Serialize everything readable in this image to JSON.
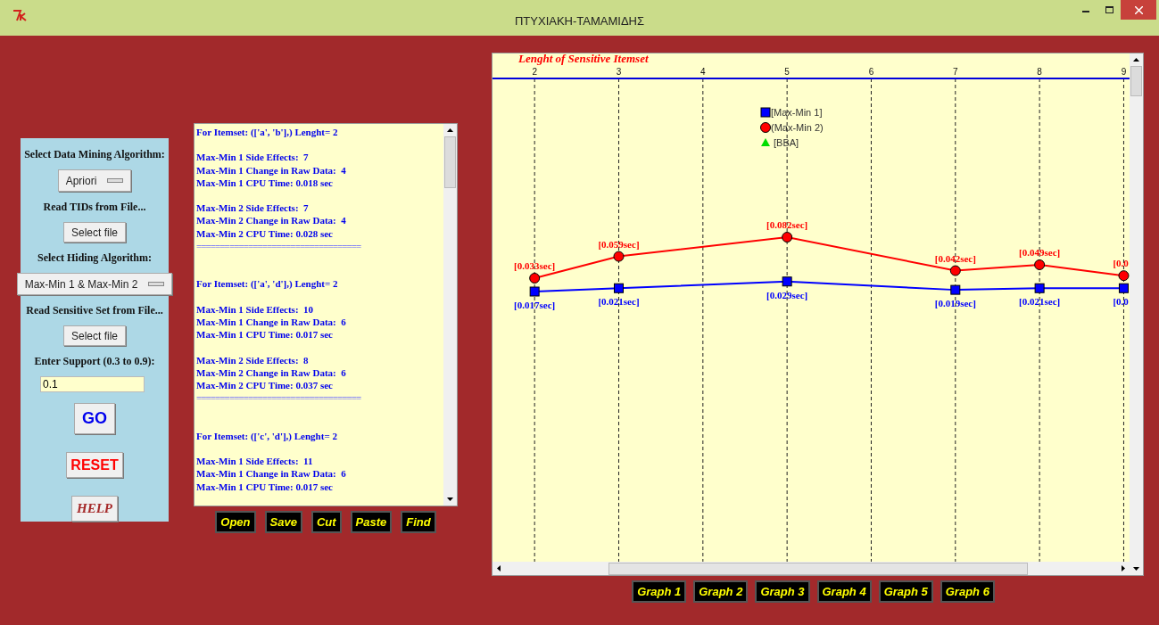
{
  "window": {
    "title": "ΠΤΥΧΙΑΚΗ-ΤΑΜΑΜΙΔΗΣ"
  },
  "controls": [
    {
      "kind": "label",
      "text": "Select Data Mining Algorithm:"
    },
    {
      "kind": "menu",
      "text": "Apriori"
    },
    {
      "kind": "label",
      "text": "Read TIDs from File..."
    },
    {
      "kind": "button",
      "text": "Select file"
    },
    {
      "kind": "label",
      "text": "Select Hiding Algorithm:"
    },
    {
      "kind": "menu",
      "text": "Max-Min 1 & Max-Min 2"
    },
    {
      "kind": "label",
      "text": "Read Sensitive Set from File..."
    },
    {
      "kind": "button",
      "text": "Select file"
    },
    {
      "kind": "label",
      "text": "Enter Support (0.3 to 0.9):"
    },
    {
      "kind": "input",
      "text": "0.1"
    },
    {
      "kind": "go",
      "text": "GO"
    },
    {
      "kind": "reset",
      "text": "RESET"
    },
    {
      "kind": "help",
      "text": "HELP"
    }
  ],
  "output": [
    {
      "kind": "text",
      "text": "For Itemset: (['a', 'b'],) Lenght= 2"
    },
    {
      "kind": "blank"
    },
    {
      "kind": "text",
      "text": "Max-Min 1 Side Effects:  7"
    },
    {
      "kind": "text",
      "text": "Max-Min 1 Change in Raw Data:  4"
    },
    {
      "kind": "text",
      "text": "Max-Min 1 CPU Time: 0.018 sec"
    },
    {
      "kind": "blank"
    },
    {
      "kind": "text",
      "text": "Max-Min 2 Side Effects:  7"
    },
    {
      "kind": "text",
      "text": "Max-Min 2 Change in Raw Data:  4"
    },
    {
      "kind": "text",
      "text": "Max-Min 2 CPU Time: 0.028 sec"
    },
    {
      "kind": "rule",
      "text": "==================================="
    },
    {
      "kind": "blank"
    },
    {
      "kind": "blank"
    },
    {
      "kind": "text",
      "text": "For Itemset: (['a', 'd'],) Lenght= 2"
    },
    {
      "kind": "blank"
    },
    {
      "kind": "text",
      "text": "Max-Min 1 Side Effects:  10"
    },
    {
      "kind": "text",
      "text": "Max-Min 1 Change in Raw Data:  6"
    },
    {
      "kind": "text",
      "text": "Max-Min 1 CPU Time: 0.017 sec"
    },
    {
      "kind": "blank"
    },
    {
      "kind": "text",
      "text": "Max-Min 2 Side Effects:  8"
    },
    {
      "kind": "text",
      "text": "Max-Min 2 Change in Raw Data:  6"
    },
    {
      "kind": "text",
      "text": "Max-Min 2 CPU Time: 0.037 sec"
    },
    {
      "kind": "rule",
      "text": "==================================="
    },
    {
      "kind": "blank"
    },
    {
      "kind": "blank"
    },
    {
      "kind": "text",
      "text": "For Itemset: (['c', 'd'],) Lenght= 2"
    },
    {
      "kind": "blank"
    },
    {
      "kind": "text",
      "text": "Max-Min 1 Side Effects:  11"
    },
    {
      "kind": "text",
      "text": "Max-Min 1 Change in Raw Data:  6"
    },
    {
      "kind": "text",
      "text": "Max-Min 1 CPU Time: 0.017 sec"
    }
  ],
  "editor_buttons": [
    "Open",
    "Save",
    "Cut",
    "Paste",
    "Find"
  ],
  "graph": {
    "chart_data": {
      "type": "line",
      "title": "Lenght of Sensitive Itemset",
      "xticks": [
        2,
        3,
        4,
        5,
        6,
        7,
        8,
        9
      ],
      "xlim": [
        1.5,
        9.08
      ],
      "grid": "x",
      "legend": "top",
      "x": [
        2,
        3,
        5,
        7,
        8,
        9
      ],
      "series": [
        {
          "name": "[Max-Min 1]",
          "color": "#0000ff",
          "marker": "square",
          "values": [
            0.017,
            0.021,
            0.029,
            0.019,
            0.021,
            0.021
          ],
          "value_labels": [
            "[0.017sec]",
            "[0.021sec]",
            "[0.029sec]",
            "[0.019sec]",
            "[0.021sec]",
            "[0.0"
          ]
        },
        {
          "name": "(Max-Min 2)",
          "color": "#ff0000",
          "marker": "circle",
          "values": [
            0.033,
            0.059,
            0.082,
            0.042,
            0.049,
            0.036
          ],
          "value_labels": [
            "[0.033sec]",
            "[0.059sec]",
            "[0.082sec]",
            "[0.042sec]",
            "[0.049sec]",
            "[0.0"
          ]
        },
        {
          "name": "[BBA]",
          "color": "#00dd00",
          "marker": "triangle",
          "values": [
            null,
            null,
            null,
            null,
            null,
            null
          ]
        }
      ]
    }
  },
  "graph_buttons": [
    "Graph 1",
    "Graph 2",
    "Graph 3",
    "Graph 4",
    "Graph 5",
    "Graph 6"
  ]
}
